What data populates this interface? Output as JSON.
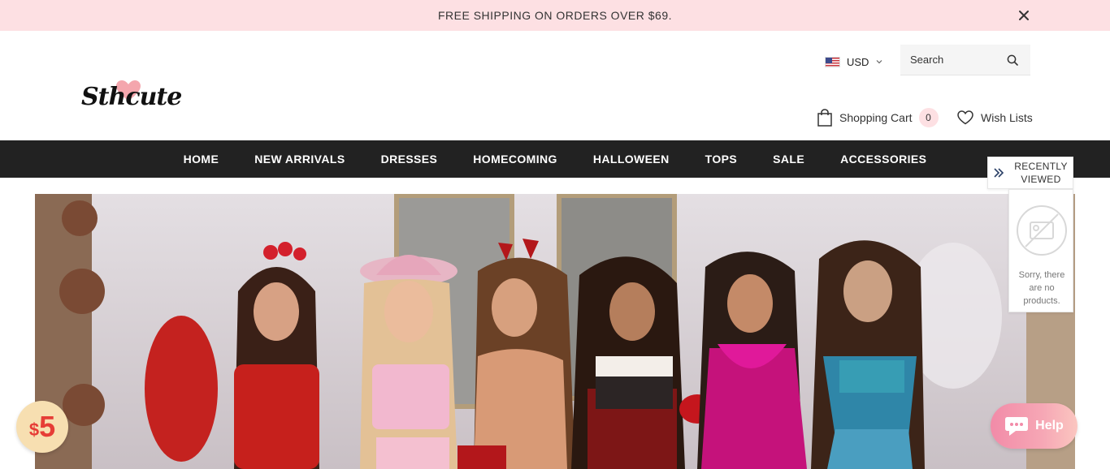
{
  "announcement": {
    "text": "FREE SHIPPING ON ORDERS OVER $69.",
    "close_icon": "close-icon"
  },
  "header": {
    "logo_text": "Sthcute",
    "currency": "USD",
    "search": {
      "placeholder": "Search"
    },
    "cart": {
      "label": "Shopping Cart",
      "count": "0"
    },
    "wishlist": {
      "label": "Wish Lists"
    }
  },
  "nav": {
    "items": [
      {
        "label": "HOME"
      },
      {
        "label": "NEW ARRIVALS"
      },
      {
        "label": "DRESSES"
      },
      {
        "label": "HOMECOMING"
      },
      {
        "label": "HALLOWEEN"
      },
      {
        "label": "TOPS"
      },
      {
        "label": "SALE"
      },
      {
        "label": "ACCESSORIES"
      }
    ]
  },
  "recently_viewed": {
    "title": "RECENTLY VIEWED",
    "empty_text": "Sorry, there are no products."
  },
  "coupon": {
    "currency": "$",
    "amount": "5"
  },
  "help": {
    "label": "Help"
  },
  "colors": {
    "accent_pink": "#fde0e3",
    "nav_bg": "#222222",
    "coupon_red": "#e63d36"
  }
}
